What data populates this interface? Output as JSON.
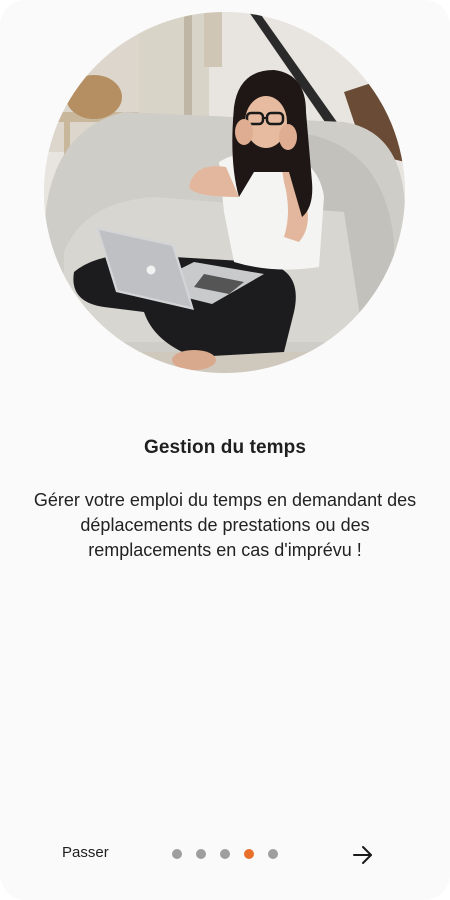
{
  "onboarding": {
    "title": "Gestion du temps",
    "description": "Gérer votre emploi du temps en demandant des déplacements de prestations ou des remplacements en cas d'imprévu !",
    "skip_label": "Passer",
    "page_count": 5,
    "current_page": 4,
    "accent_color": "#e8702a",
    "inactive_dot_color": "#9e9e9e",
    "next_icon": "arrow-right-icon",
    "hero_image": "woman-with-headphones-and-laptop-on-sofa"
  }
}
